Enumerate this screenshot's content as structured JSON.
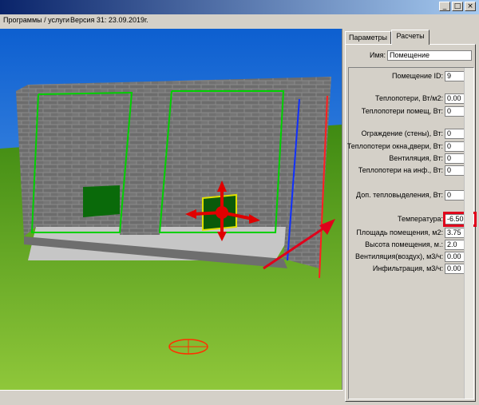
{
  "window": {
    "controls": [
      "_",
      "□",
      "×"
    ]
  },
  "menubar": {
    "programs": "Программы / услуги",
    "version": "Версия 31: 23.09.2019г."
  },
  "tabs": [
    {
      "label": "Параметры"
    },
    {
      "label": "Расчеты"
    }
  ],
  "name_field": {
    "label": "Имя:",
    "value": "Помещение"
  },
  "fields": [
    {
      "label": "Помещение ID:",
      "value": "9"
    },
    {
      "label": "Теплопотери, Вт/м2:",
      "value": "0.00"
    },
    {
      "label": "Теплопотери помещ, Вт:",
      "value": "0"
    },
    {
      "label": "Ограждение (стены), Вт:",
      "value": "0"
    },
    {
      "label": "Теплопотери окна,двери, Вт:",
      "value": "0"
    },
    {
      "label": "Вентиляция, Вт:",
      "value": "0"
    },
    {
      "label": "Теплопотери на инф., Вт:",
      "value": "0"
    },
    {
      "label": "Доп. тепловыделения, Вт:",
      "value": "0"
    },
    {
      "label": "Температура:",
      "value": "-6.50"
    },
    {
      "label": "Площадь помещения, м2:",
      "value": "3.75"
    },
    {
      "label": "Высота помещения, м.:",
      "value": "2.0"
    },
    {
      "label": "Вентиляция(воздух), м3/ч:",
      "value": "0.00"
    },
    {
      "label": "Инфильтрация, м3/ч:",
      "value": "0.00"
    }
  ],
  "colors": {
    "highlight": "#e0001b",
    "sky": "#1c6fd6",
    "grass": "#4e9a1c",
    "wall": "#7a7a7a"
  }
}
